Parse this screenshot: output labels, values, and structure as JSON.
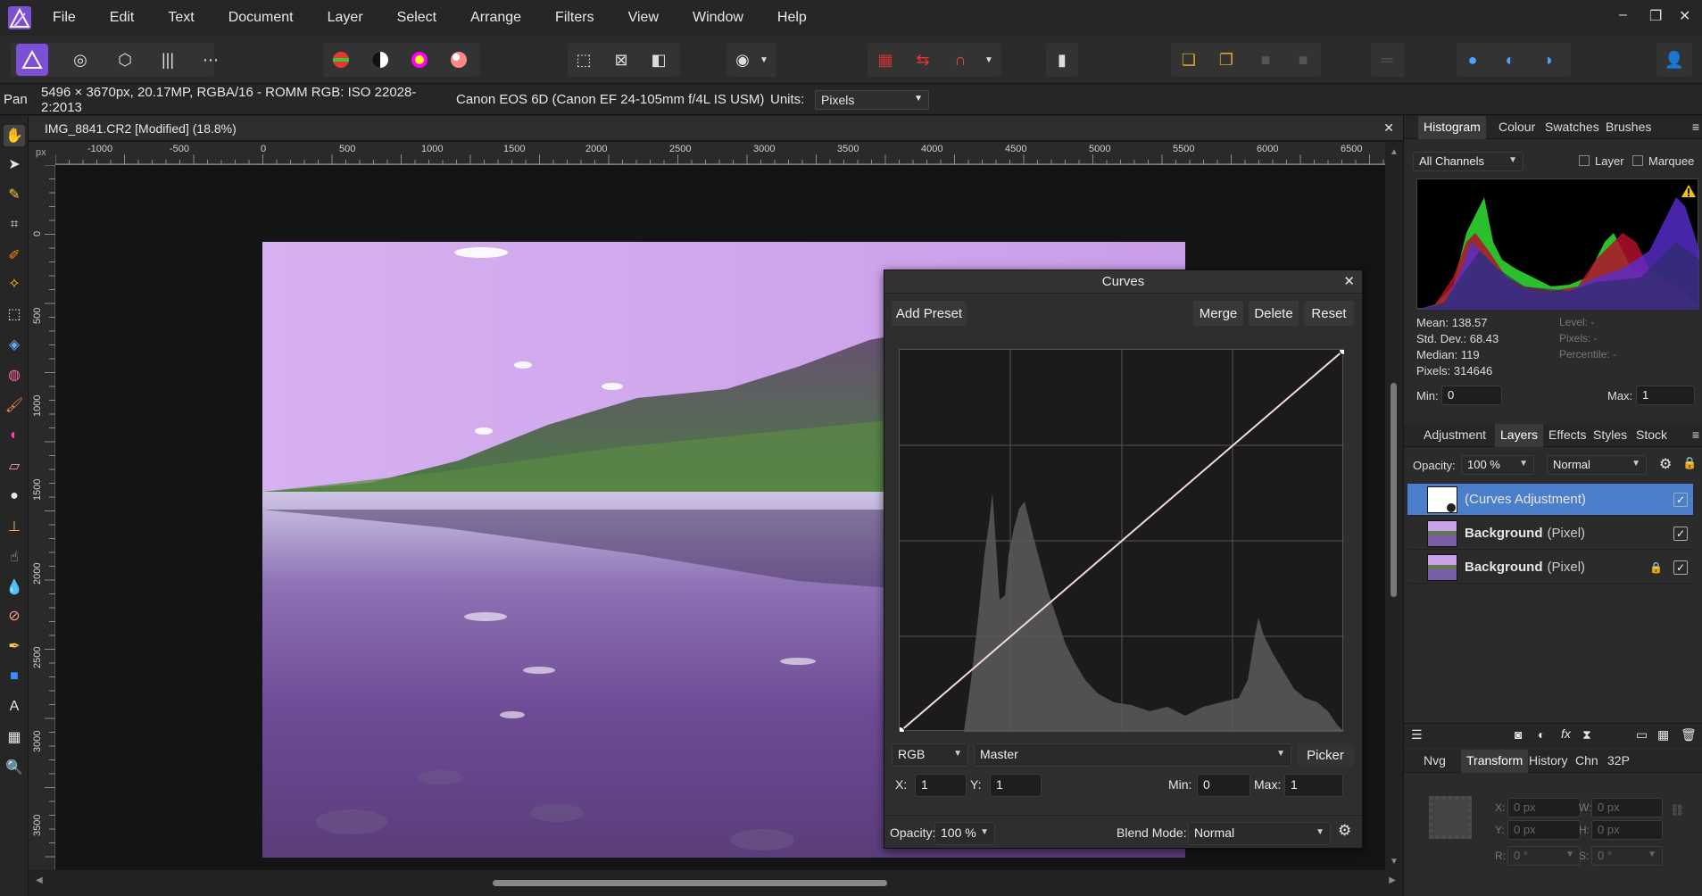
{
  "menu": [
    "File",
    "Edit",
    "Text",
    "Document",
    "Layer",
    "Select",
    "Arrange",
    "Filters",
    "View",
    "Window",
    "Help"
  ],
  "window_controls": [
    "–",
    "❐",
    "✕"
  ],
  "context": {
    "tool": "Pan",
    "image_info": "5496 × 3670px, 20.17MP, RGBA/16 - ROMM RGB: ISO 22028-2:2013",
    "camera": "Canon EOS 6D (Canon EF 24-105mm f/4L IS USM)",
    "units_label": "Units:",
    "units_value": "Pixels"
  },
  "document": {
    "tab_title": "IMG_8841.CR2 [Modified] (18.8%)",
    "ruler_unit": "px",
    "h_ticks": [
      "-1000",
      "-500",
      "0",
      "500",
      "1000",
      "1500",
      "2000",
      "2500",
      "3000",
      "3500",
      "4000",
      "4500",
      "5000",
      "5500",
      "6000",
      "6500"
    ],
    "v_ticks": [
      "0",
      "500",
      "1000",
      "1500",
      "2000",
      "2500",
      "3000",
      "3500"
    ]
  },
  "curves": {
    "title": "Curves",
    "add_preset": "Add Preset",
    "merge": "Merge",
    "delete": "Delete",
    "reset": "Reset",
    "channel_mode": "RGB",
    "channel": "Master",
    "picker": "Picker",
    "x_label": "X:",
    "x_value": "1",
    "y_label": "Y:",
    "y_value": "1",
    "min_label": "Min:",
    "min_value": "0",
    "max_label": "Max:",
    "max_value": "1",
    "opacity_label": "Opacity:",
    "opacity_value": "100 %",
    "blend_label": "Blend Mode:",
    "blend_value": "Normal"
  },
  "histogram_panel": {
    "tabs": [
      "Histogram",
      "Colour",
      "Swatches",
      "Brushes"
    ],
    "channels": "All Channels",
    "layer_label": "Layer",
    "marquee_label": "Marquee",
    "mean": "Mean: 138.57",
    "std": "Std. Dev.: 68.43",
    "median": "Median: 119",
    "pixels": "Pixels: 314646",
    "level": "Level: -",
    "pixels_sel": "Pixels: -",
    "percentile": "Percentile: -",
    "min_label": "Min:",
    "min_value": "0",
    "max_label": "Max:",
    "max_value": "1"
  },
  "layers_panel": {
    "tabs": [
      "Adjustment",
      "Layers",
      "Effects",
      "Styles",
      "Stock"
    ],
    "opacity_label": "Opacity:",
    "opacity_value": "100 %",
    "blend": "Normal",
    "layers": [
      {
        "name": "(Curves Adjustment)",
        "kind": ""
      },
      {
        "name": "Background",
        "kind": "(Pixel)"
      },
      {
        "name": "Background",
        "kind": "(Pixel)"
      }
    ]
  },
  "transform_panel": {
    "tabs": [
      "Nvg",
      "Transform",
      "History",
      "Chn",
      "32P"
    ],
    "x_label": "X:",
    "x": "0 px",
    "y_label": "Y:",
    "y": "0 px",
    "w_label": "W:",
    "w": "0 px",
    "h_label": "H:",
    "h": "0 px",
    "r_label": "R:",
    "r": "0 °",
    "s_label": "S:",
    "s": "0 °"
  },
  "colors": {
    "accent": "#4b7fcb",
    "brand": "#7b4fd6",
    "sky": "#c99ee8"
  }
}
